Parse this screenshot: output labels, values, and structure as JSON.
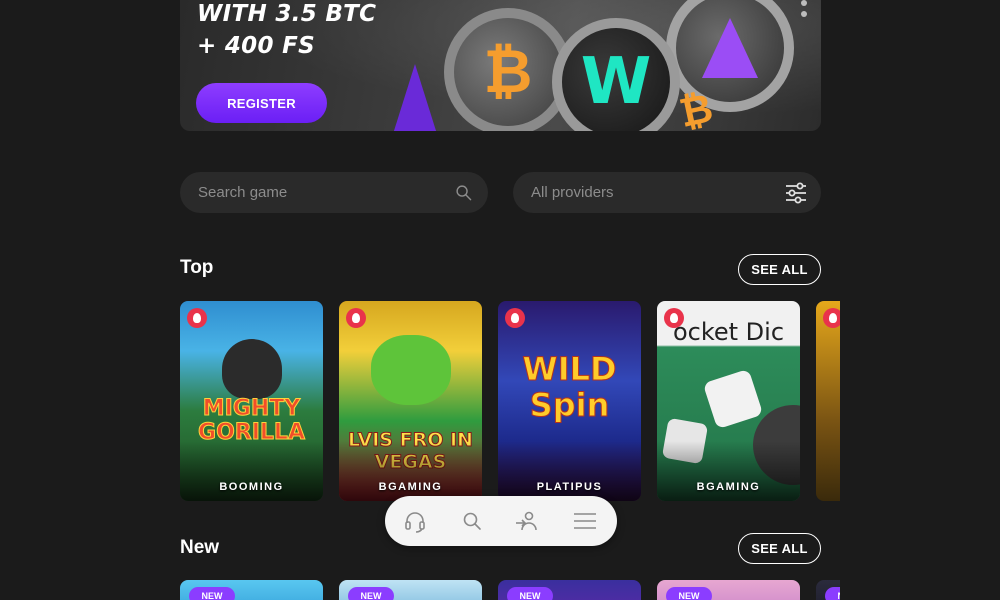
{
  "banner": {
    "promo_line1": "WITH 3.5 BTC",
    "promo_line2": "+ 400 FS",
    "register_label": "REGISTER"
  },
  "search": {
    "placeholder": "Search game",
    "providers_placeholder": "All providers"
  },
  "sections": {
    "top": {
      "title": "Top",
      "see_all_label": "SEE ALL",
      "games": [
        {
          "title_art": "MIGHTY GORILLA",
          "provider": "BOOMING"
        },
        {
          "title_art": "LVIS FRO IN VEGAS",
          "provider": "BGAMING"
        },
        {
          "title_art": "WILD Spin",
          "provider": "PLATIPUS"
        },
        {
          "title_art": "ocket Dic",
          "provider": "BGAMING"
        },
        {
          "title_art": "",
          "provider": ""
        }
      ]
    },
    "new": {
      "title": "New",
      "see_all_label": "SEE ALL",
      "badge_label": "NEW"
    }
  },
  "bottom_nav": {
    "icons": [
      "headset-icon",
      "search-icon",
      "login-icon",
      "menu-icon"
    ]
  },
  "colors": {
    "accent": "#7a2cff",
    "background": "#1b1b1b",
    "field_bg": "#2a2a2a",
    "hot_badge": "#e9334b"
  }
}
